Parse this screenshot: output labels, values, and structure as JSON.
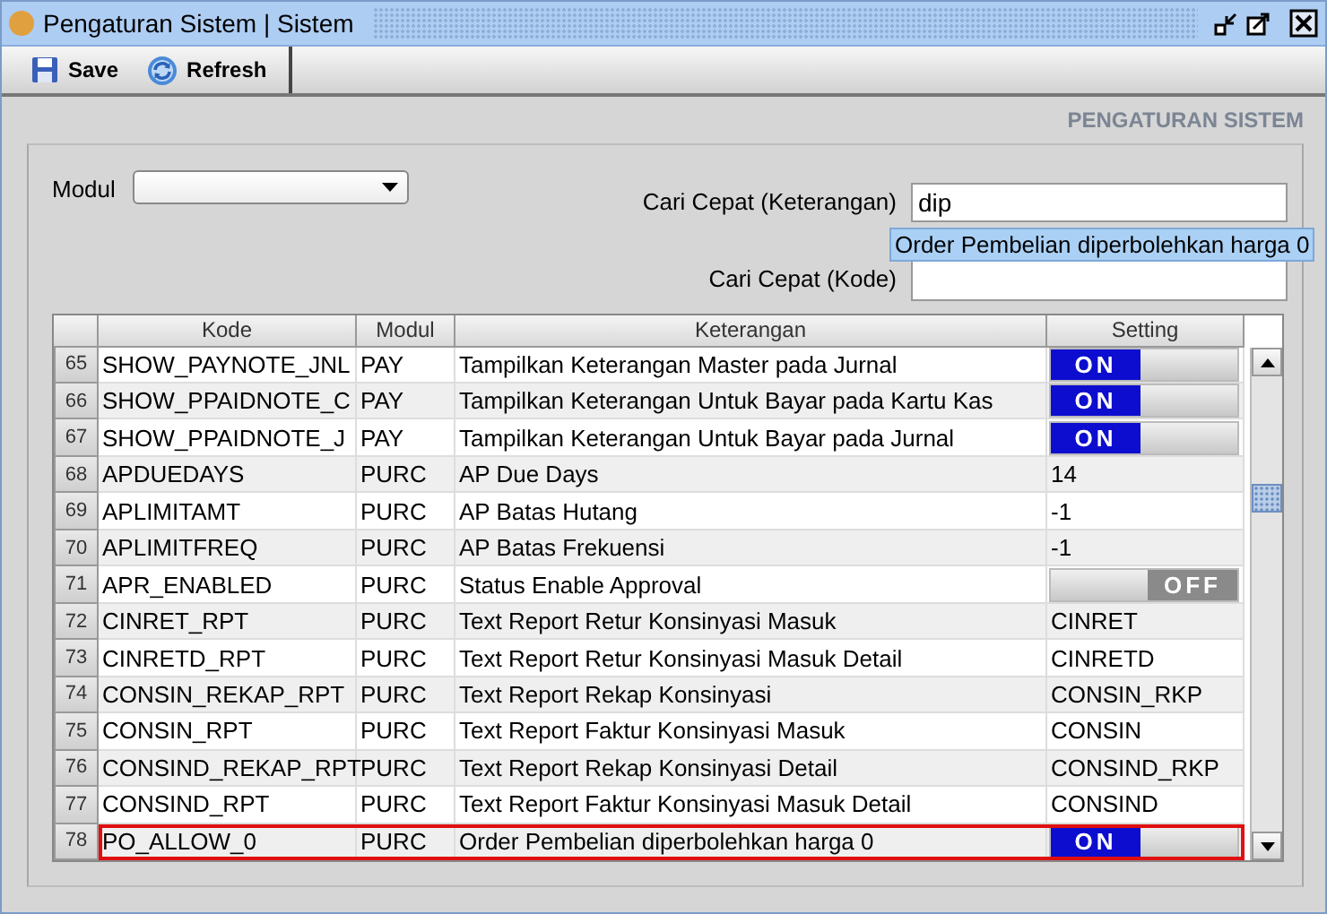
{
  "window": {
    "title": "Pengaturan Sistem | Sistem"
  },
  "toolbar": [
    {
      "kind": "save",
      "label": "Save"
    },
    {
      "kind": "refresh",
      "label": "Refresh"
    }
  ],
  "panel_title": "PENGATURAN SISTEM",
  "filters": {
    "modul": {
      "label": "Modul"
    },
    "search_description": {
      "label": "Cari Cepat (Keterangan)",
      "value": "dip"
    },
    "search_code": {
      "label": "Cari Cepat (Kode)"
    },
    "suggestion": "Order Pembelian diperbolehkan harga 0"
  },
  "table": {
    "columns": [
      "Kode",
      "Modul",
      "Keterangan",
      "Setting"
    ],
    "rows": [
      {
        "number": "65",
        "kode": "SHOW_PAYNOTE_JNL",
        "modul": "PAY",
        "keterangan": "Tampilkan Keterangan Master pada Jurnal",
        "setting": {
          "kind": "toggle",
          "on": true,
          "label": "ON"
        },
        "selected": false
      },
      {
        "number": "66",
        "kode": "SHOW_PPAIDNOTE_C",
        "modul": "PAY",
        "keterangan": "Tampilkan Keterangan Untuk Bayar pada Kartu Kas",
        "setting": {
          "kind": "toggle",
          "on": true,
          "label": "ON"
        },
        "selected": false
      },
      {
        "number": "67",
        "kode": "SHOW_PPAIDNOTE_J",
        "modul": "PAY",
        "keterangan": "Tampilkan Keterangan Untuk Bayar pada Jurnal",
        "setting": {
          "kind": "toggle",
          "on": true,
          "label": "ON"
        },
        "selected": false
      },
      {
        "number": "68",
        "kode": "APDUEDAYS",
        "modul": "PURC",
        "keterangan": "AP Due Days",
        "setting": {
          "kind": "text",
          "value": "14"
        },
        "selected": false
      },
      {
        "number": "69",
        "kode": "APLIMITAMT",
        "modul": "PURC",
        "keterangan": "AP Batas Hutang",
        "setting": {
          "kind": "text",
          "value": "-1"
        },
        "selected": false
      },
      {
        "number": "70",
        "kode": "APLIMITFREQ",
        "modul": "PURC",
        "keterangan": "AP Batas Frekuensi",
        "setting": {
          "kind": "text",
          "value": "-1"
        },
        "selected": false
      },
      {
        "number": "71",
        "kode": "APR_ENABLED",
        "modul": "PURC",
        "keterangan": "Status Enable Approval",
        "setting": {
          "kind": "toggle",
          "on": false,
          "label": "OFF"
        },
        "selected": false
      },
      {
        "number": "72",
        "kode": "CINRET_RPT",
        "modul": "PURC",
        "keterangan": "Text Report Retur Konsinyasi Masuk",
        "setting": {
          "kind": "text",
          "value": "CINRET"
        },
        "selected": false
      },
      {
        "number": "73",
        "kode": "CINRETD_RPT",
        "modul": "PURC",
        "keterangan": "Text Report Retur Konsinyasi Masuk Detail",
        "setting": {
          "kind": "text",
          "value": "CINRETD"
        },
        "selected": false
      },
      {
        "number": "74",
        "kode": "CONSIN_REKAP_RPT",
        "modul": "PURC",
        "keterangan": "Text Report Rekap Konsinyasi",
        "setting": {
          "kind": "text",
          "value": "CONSIN_RKP"
        },
        "selected": false
      },
      {
        "number": "75",
        "kode": "CONSIN_RPT",
        "modul": "PURC",
        "keterangan": "Text Report Faktur Konsinyasi Masuk",
        "setting": {
          "kind": "text",
          "value": "CONSIN"
        },
        "selected": false
      },
      {
        "number": "76",
        "kode": "CONSIND_REKAP_RPT",
        "modul": "PURC",
        "keterangan": "Text Report Rekap Konsinyasi Detail",
        "setting": {
          "kind": "text",
          "value": "CONSIND_RKP"
        },
        "selected": false
      },
      {
        "number": "77",
        "kode": "CONSIND_RPT",
        "modul": "PURC",
        "keterangan": "Text Report Faktur Konsinyasi Masuk Detail",
        "setting": {
          "kind": "text",
          "value": "CONSIND"
        },
        "selected": false
      },
      {
        "number": "78",
        "kode": "PO_ALLOW_0",
        "modul": "PURC",
        "keterangan": "Order Pembelian diperbolehkan harga 0",
        "setting": {
          "kind": "toggle",
          "on": true,
          "label": "ON"
        },
        "selected": true
      }
    ]
  }
}
